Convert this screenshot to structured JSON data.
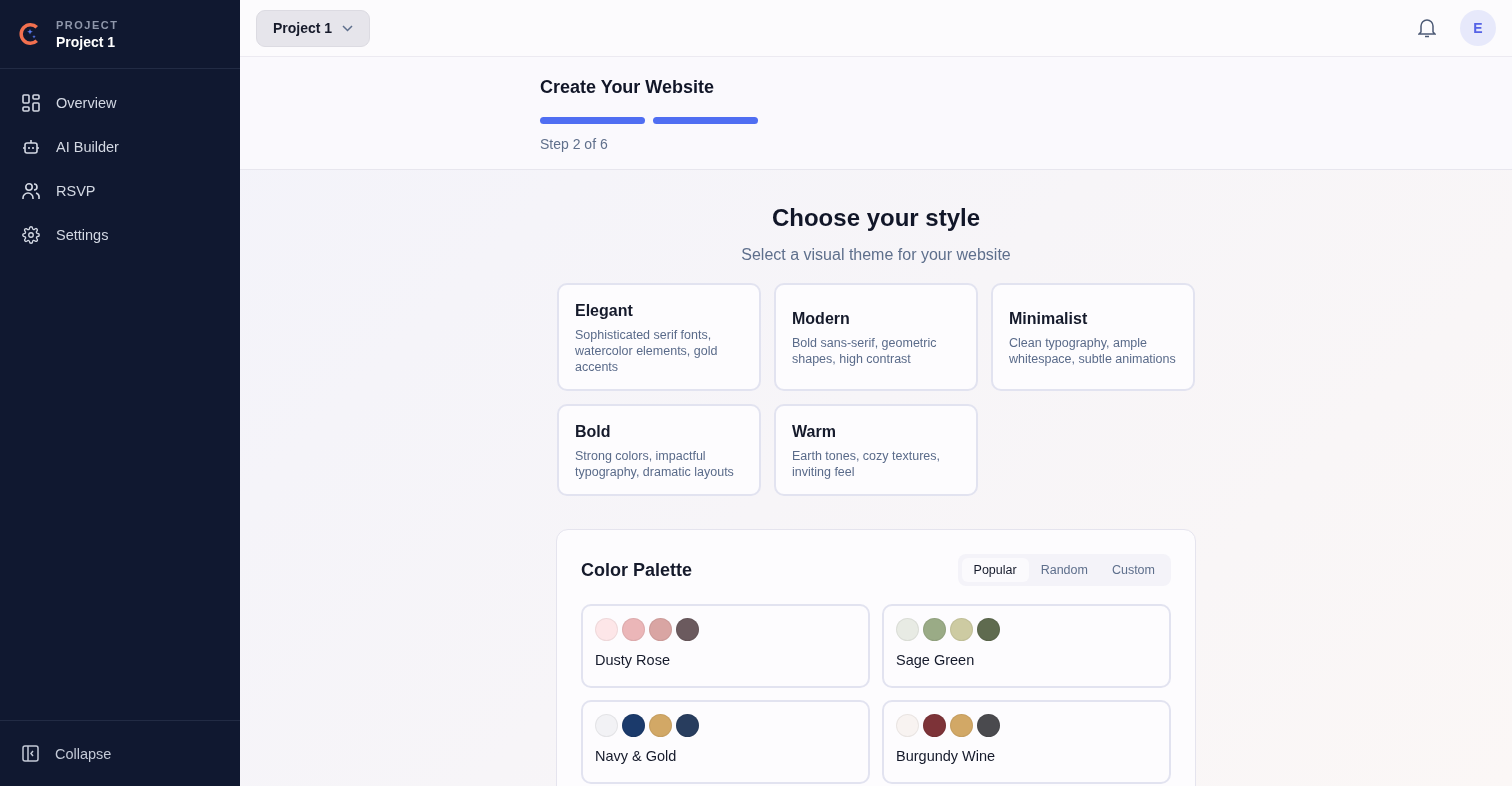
{
  "sidebar": {
    "project_label": "PROJECT",
    "project_name": "Project 1",
    "items": [
      {
        "label": "Overview",
        "selected": false
      },
      {
        "label": "AI Builder",
        "selected": false
      },
      {
        "label": "RSVP",
        "selected": false
      },
      {
        "label": "Settings",
        "selected": false
      }
    ],
    "collapse": "Collapse"
  },
  "topbar": {
    "project_button": "Project 1",
    "avatar": "E"
  },
  "wizard": {
    "title": "Create Your Website",
    "progress": [
      {
        "done": true
      },
      {
        "done": true
      }
    ],
    "step": "Step 2 of 6"
  },
  "style_section": {
    "title": "Choose your style",
    "subtitle": "Select a visual theme for your website",
    "styles": [
      {
        "name": "Elegant",
        "description": "Sophisticated serif fonts, watercolor elements, gold accents"
      },
      {
        "name": "Modern",
        "description": "Bold sans-serif, geometric shapes, high contrast"
      },
      {
        "name": "Minimalist",
        "description": "Clean typography, ample whitespace, subtle animations"
      },
      {
        "name": "Bold",
        "description": "Strong colors, impactful typography, dramatic layouts"
      },
      {
        "name": "Warm",
        "description": "Earth tones, cozy textures, inviting feel"
      }
    ]
  },
  "color_palette": {
    "title": "Color Palette",
    "tabs": [
      {
        "label": "Popular",
        "selected": true
      },
      {
        "label": "Random",
        "selected": false
      },
      {
        "label": "Custom",
        "selected": false
      }
    ],
    "palettes": [
      {
        "name": "Dusty Rose",
        "swatches": [
          {
            "color": "#fde6e8"
          },
          {
            "color": "#ebb6b8"
          },
          {
            "color": "#d9a5a3"
          },
          {
            "color": "#6b5a5e"
          }
        ]
      },
      {
        "name": "Sage Green",
        "swatches": [
          {
            "color": "#e8ebe4"
          },
          {
            "color": "#9aab86"
          },
          {
            "color": "#cdcba2"
          },
          {
            "color": "#5f6b4f"
          }
        ]
      },
      {
        "name": "Navy & Gold",
        "swatches": [
          {
            "color": "#f2f2f5"
          },
          {
            "color": "#1b3a6b"
          },
          {
            "color": "#d2a866"
          },
          {
            "color": "#283d5e"
          }
        ]
      },
      {
        "name": "Burgundy Wine",
        "swatches": [
          {
            "color": "#f8f3f1"
          },
          {
            "color": "#7d3338"
          },
          {
            "color": "#d2a866"
          },
          {
            "color": "#4a4a4e"
          }
        ]
      }
    ]
  }
}
